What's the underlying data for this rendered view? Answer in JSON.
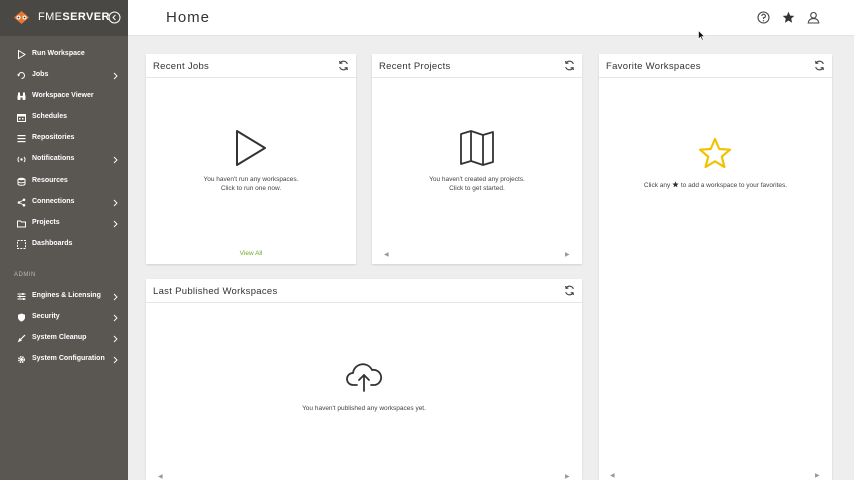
{
  "brand": {
    "name_light": "FME",
    "name_bold": "SERVER"
  },
  "header": {
    "title": "Home"
  },
  "sidebar": {
    "items": [
      {
        "label": "Run Workspace",
        "icon": "play-icon",
        "has_children": false
      },
      {
        "label": "Jobs",
        "icon": "history-icon",
        "has_children": true
      },
      {
        "label": "Workspace Viewer",
        "icon": "binoculars-icon",
        "has_children": false
      },
      {
        "label": "Schedules",
        "icon": "calendar-icon",
        "has_children": false
      },
      {
        "label": "Repositories",
        "icon": "list-icon",
        "has_children": false
      },
      {
        "label": "Notifications",
        "icon": "signal-icon",
        "has_children": true
      },
      {
        "label": "Resources",
        "icon": "database-icon",
        "has_children": false
      },
      {
        "label": "Connections",
        "icon": "share-icon",
        "has_children": true
      },
      {
        "label": "Projects",
        "icon": "folder-icon",
        "has_children": true
      },
      {
        "label": "Dashboards",
        "icon": "dashboard-icon",
        "has_children": false
      }
    ],
    "admin_label": "ADMIN",
    "admin_items": [
      {
        "label": "Engines & Licensing",
        "icon": "sliders-icon",
        "has_children": true
      },
      {
        "label": "Security",
        "icon": "shield-icon",
        "has_children": true
      },
      {
        "label": "System Cleanup",
        "icon": "broom-icon",
        "has_children": true
      },
      {
        "label": "System Configuration",
        "icon": "gear-icon",
        "has_children": true
      }
    ]
  },
  "cards": {
    "recent_jobs": {
      "title": "Recent Jobs",
      "empty_line1": "You haven't run any workspaces.",
      "empty_line2": "Click to run one now.",
      "view_all": "View All"
    },
    "recent_projects": {
      "title": "Recent Projects",
      "empty_line1": "You haven't created any projects.",
      "empty_line2": "Click to get started."
    },
    "favorite_workspaces": {
      "title": "Favorite Workspaces",
      "empty_before": "Click any",
      "empty_after": "to add a workspace to your favorites."
    },
    "last_published": {
      "title": "Last Published Workspaces",
      "empty_line1": "You haven't published any workspaces yet."
    }
  },
  "pager": {
    "prev": "◀",
    "next": "▶"
  },
  "colors": {
    "sidebar": "#5a5753",
    "accent_green": "#6cab2c",
    "star_yellow": "#f2c200"
  }
}
